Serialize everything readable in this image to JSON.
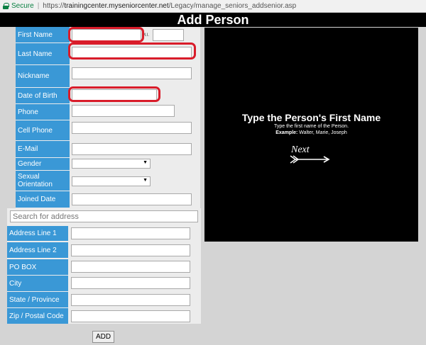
{
  "browser": {
    "secure_label": "Secure",
    "url_scheme": "https://",
    "url_host": "trainingcenter.myseniorcenter.net",
    "url_path": "/Legacy/manage_seniors_addsenior.asp"
  },
  "page": {
    "title": "Add Person"
  },
  "form": {
    "first_name": {
      "label": "First Name",
      "value": ""
    },
    "middle_initial": {
      "label": "M.I.",
      "value": ""
    },
    "last_name": {
      "label": "Last Name",
      "value": ""
    },
    "nickname": {
      "label": "Nickname",
      "value": ""
    },
    "dob": {
      "label": "Date of Birth",
      "value": ""
    },
    "phone": {
      "label": "Phone",
      "value": ""
    },
    "cell_phone": {
      "label": "Cell Phone",
      "value": ""
    },
    "email": {
      "label": "E-Mail",
      "value": ""
    },
    "gender": {
      "label": "Gender",
      "value": ""
    },
    "orientation": {
      "label": "Sexual Orientation",
      "value": ""
    },
    "joined_date": {
      "label": "Joined Date",
      "value": ""
    }
  },
  "address": {
    "search_placeholder": "Search for address",
    "line1": {
      "label": "Address Line 1",
      "value": ""
    },
    "line2": {
      "label": "Address Line 2",
      "value": ""
    },
    "po_box": {
      "label": "PO BOX",
      "value": ""
    },
    "city": {
      "label": "City",
      "value": ""
    },
    "state": {
      "label": "State / Province",
      "value": ""
    },
    "zip": {
      "label": "Zip / Postal Code",
      "value": ""
    }
  },
  "add_button": "ADD",
  "tutorial": {
    "title": "Type the Person's First Name",
    "subtitle": "Type the first name of the Person.",
    "example_label": "Example:",
    "example_text": " Walter, Marie, Joseph",
    "next_label": "Next"
  },
  "colors": {
    "label_bg": "#3a98d6",
    "highlight_ring": "#d91c2a",
    "title_bar": "#000000",
    "secure_green": "#0b8043"
  }
}
